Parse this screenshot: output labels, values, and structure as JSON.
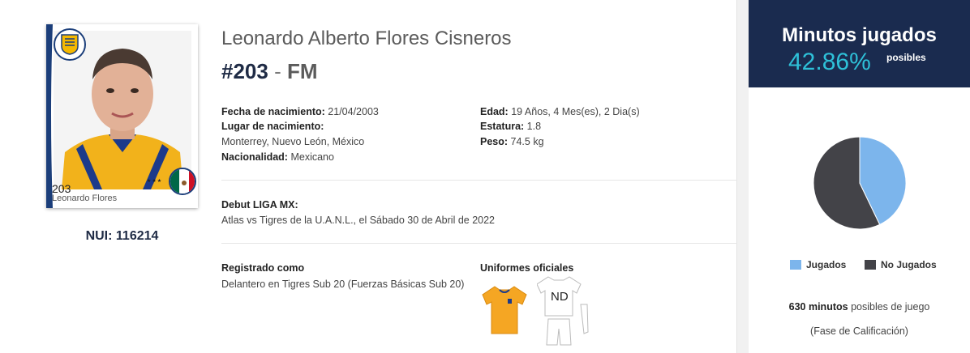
{
  "player": {
    "photo_number": "203",
    "photo_name": "Leonardo Flores",
    "nui_label": "NUI:",
    "nui_value": "116214",
    "full_name": "Leonardo Alberto Flores Cisneros",
    "number": "#203",
    "separator": "-",
    "position": "FM"
  },
  "details": {
    "birth_date_label": "Fecha de nacimiento:",
    "birth_date_value": "21/04/2003",
    "birth_place_label": "Lugar de nacimiento:",
    "birth_place_value": "Monterrey, Nuevo León, México",
    "nationality_label": "Nacionalidad:",
    "nationality_value": "Mexicano",
    "age_label": "Edad:",
    "age_value": "19 Años, 4 Mes(es), 2 Dia(s)",
    "height_label": "Estatura:",
    "height_value": "1.8",
    "weight_label": "Peso:",
    "weight_value": "74.5 kg"
  },
  "debut": {
    "title": "Debut LIGA MX:",
    "text": "Atlas vs Tigres de la U.A.N.L., el Sábado 30 de Abril de 2022"
  },
  "registration": {
    "title": "Registrado como",
    "text": "Delantero en Tigres Sub 20 (Fuerzas Básicas Sub 20)"
  },
  "uniforms": {
    "title": "Uniformes oficiales",
    "away_label": "ND"
  },
  "minutes": {
    "title": "Minutos jugados",
    "percent": "42.86%",
    "percent_label": "posibles",
    "legend_played": "Jugados",
    "legend_not_played": "No Jugados",
    "total_minutes": "630 minutos",
    "total_suffix": "posibles de juego",
    "phase": "(Fase de Calificación)",
    "played_fraction": 0.4286,
    "color_played": "#7cb5ec",
    "color_not_played": "#434348"
  },
  "colors": {
    "navy": "#1a2b4f",
    "accent": "#2ec0d8",
    "jersey_home": "#f5a623"
  }
}
